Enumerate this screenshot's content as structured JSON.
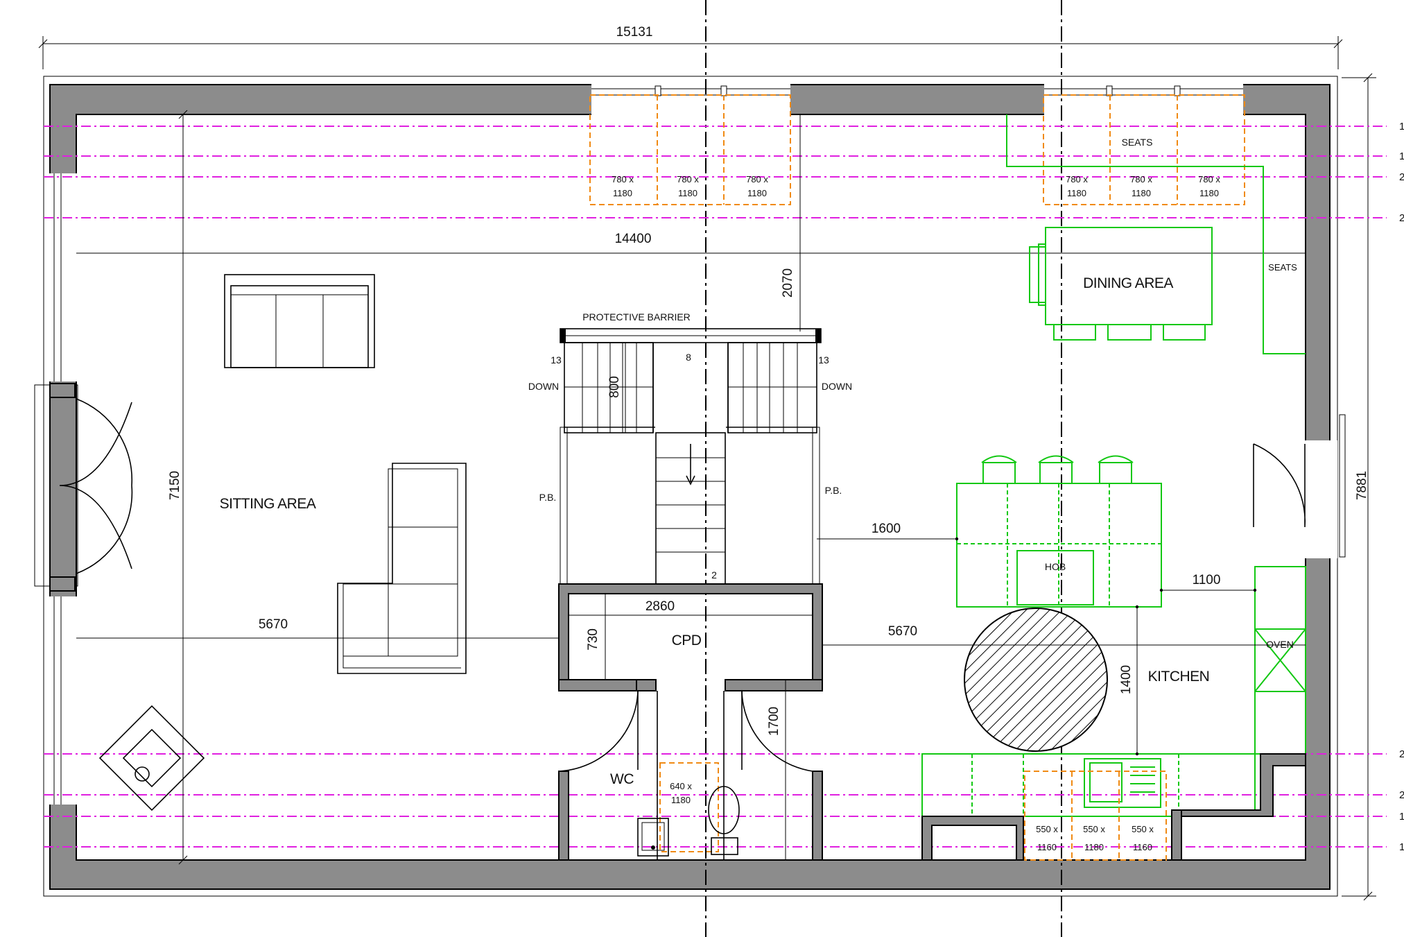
{
  "dimensions": {
    "overall_width": "15131",
    "overall_depth": "7881",
    "internal_width": "14400",
    "internal_depth": "7150",
    "window_to_stair": "2070",
    "stair_width": "800",
    "stair_to_hob": "1600",
    "cupboard_width": "2860",
    "cupboard_depth": "730",
    "sitting_to_cupboard": "5670",
    "cupboard_to_kitchen": "5670",
    "hob_to_wall": "1100",
    "worktop_clearance": "1400",
    "wc_door_clearance": "1700"
  },
  "rooms": {
    "sitting": "SITTING AREA",
    "dining": "DINING AREA",
    "kitchen": "KITCHEN",
    "wc": "WC",
    "cupboard": "CPD"
  },
  "labels": {
    "barrier": "PROTECTIVE BARRIER",
    "stair_left_count": "13",
    "stair_left_dir": "DOWN",
    "stair_right_count": "13",
    "stair_right_dir": "DOWN",
    "stair_center_count": "8",
    "stair_bottom_step": "2",
    "pb_left": "P.B.",
    "pb_right": "P.B.",
    "seats_top": "SEATS",
    "seats_side": "SEATS",
    "hob": "HOB",
    "oven": "OVEN"
  },
  "clearance_zones": {
    "top_left": [
      {
        "w": "780 x",
        "h": "1180"
      },
      {
        "w": "780 x",
        "h": "1180"
      },
      {
        "w": "780 x",
        "h": "1180"
      }
    ],
    "top_right": [
      {
        "w": "780 x",
        "h": "1180"
      },
      {
        "w": "780 x",
        "h": "1180"
      },
      {
        "w": "780 x",
        "h": "1180"
      }
    ],
    "wc": {
      "w": "640 x",
      "h": "1180"
    },
    "kitchen": [
      {
        "w": "550 x",
        "h": "1160"
      },
      {
        "w": "550 x",
        "h": "1180"
      },
      {
        "w": "550 x",
        "h": "1160"
      }
    ]
  },
  "gridline_ticks": [
    "1",
    "1",
    "2",
    "2",
    "2",
    "2",
    "1",
    "1"
  ],
  "colors": {
    "wall": "#8c8c8c",
    "furniture_green": "#13c813",
    "clearance_orange": "#f08a14",
    "gridline_magenta": "#e020e0"
  }
}
